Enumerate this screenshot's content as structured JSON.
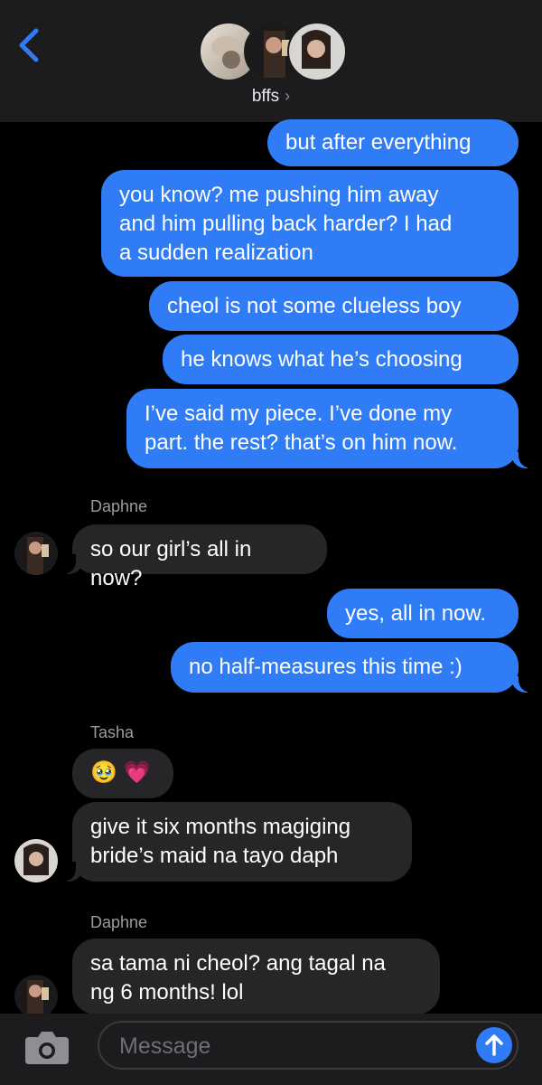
{
  "header": {
    "group_name": "bffs",
    "chevron": "›"
  },
  "messages": {
    "m1": "but after everything",
    "m2": "you know? me pushing him away\nand him pulling back harder? I had\na sudden realization",
    "m3": "cheol is not some clueless boy",
    "m4": "he knows what he’s choosing",
    "m5": "I’ve said my piece. I’ve done my\npart. the rest? that’s on him now.",
    "sender1": "Daphne",
    "m6": "so our girl’s all in now?",
    "m7": "yes, all in now.",
    "m8": "no half-measures this time :)",
    "sender2": "Tasha",
    "m9": "🥹 💗",
    "m10": "give it six months magiging\nbride’s maid na tayo daph",
    "sender3": "Daphne",
    "m11": "sa tama ni cheol? ang tagal na\nng 6 months! lol"
  },
  "composer": {
    "placeholder": "Message"
  },
  "colors": {
    "outgoing": "#2f7cf6",
    "incoming": "#262628",
    "header": "#1c1c1e"
  }
}
